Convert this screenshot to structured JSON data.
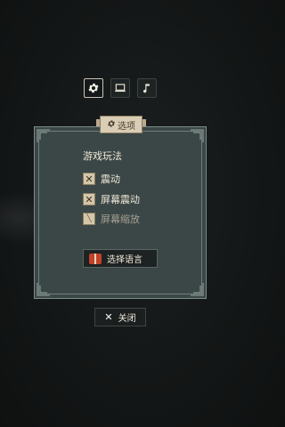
{
  "tabs": [
    {
      "icon": "gear-icon",
      "active": true
    },
    {
      "icon": "laptop-icon",
      "active": false
    },
    {
      "icon": "music-note-icon",
      "active": false
    }
  ],
  "ribbon": {
    "label": "选项",
    "icon": "gear-icon"
  },
  "section": {
    "title": "游戏玩法"
  },
  "options": [
    {
      "label": "震动",
      "state": "checked"
    },
    {
      "label": "屏幕震动",
      "state": "checked"
    },
    {
      "label": "屏幕缩放",
      "state": "partial"
    }
  ],
  "language_button": {
    "label": "选择语言",
    "icon": "book-icon"
  },
  "close_button": {
    "label": "关闭",
    "icon": "close-icon"
  },
  "colors": {
    "panel": "#3b4746",
    "paper": "#d4c6a7",
    "button_dark": "#1d2222"
  }
}
